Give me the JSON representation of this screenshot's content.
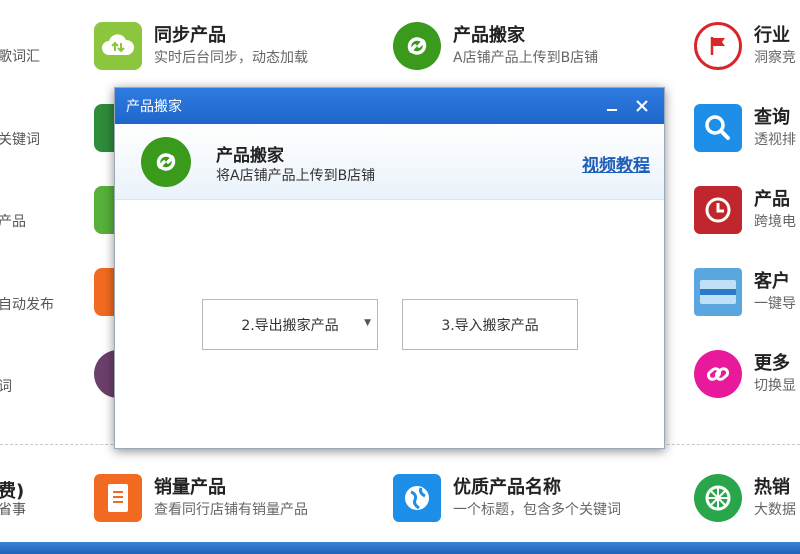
{
  "left_edge": {
    "row1": "歌词汇",
    "row2": "关键词",
    "row3": "产品",
    "row4": "自动发布",
    "row5": "词",
    "bottom_title": "费)",
    "bottom_sub": "省事"
  },
  "tiles": {
    "sync": {
      "title": "同步产品",
      "desc": "实时后台同步，动态加载"
    },
    "move": {
      "title": "产品搬家",
      "desc": "A店铺产品上传到B店铺"
    },
    "industry": {
      "title": "行业",
      "desc": "洞察竞"
    },
    "query": {
      "title": "查询",
      "desc": "透视排"
    },
    "product_pkg": {
      "title": "产品",
      "desc": "跨境电"
    },
    "customer": {
      "title": "客户",
      "desc": "一键导"
    },
    "more": {
      "title": "更多",
      "desc": "切换显"
    },
    "sales": {
      "title": "销量产品",
      "desc": "查看同行店铺有销量产品"
    },
    "quality": {
      "title": "优质产品名称",
      "desc": "一个标题，包含多个关键词"
    },
    "hot": {
      "title": "热销",
      "desc": "大数据"
    }
  },
  "dialog": {
    "window_title": "产品搬家",
    "header_title": "产品搬家",
    "header_subtitle": "将A店铺产品上传到B店铺",
    "video_link": "视频教程",
    "export_select": "2.导出搬家产品",
    "import_button": "3.导入搬家产品"
  },
  "colors": {
    "title_bar": "#2f7be0",
    "link": "#1f5fb8",
    "bottom_bar": "#2a72cc"
  }
}
